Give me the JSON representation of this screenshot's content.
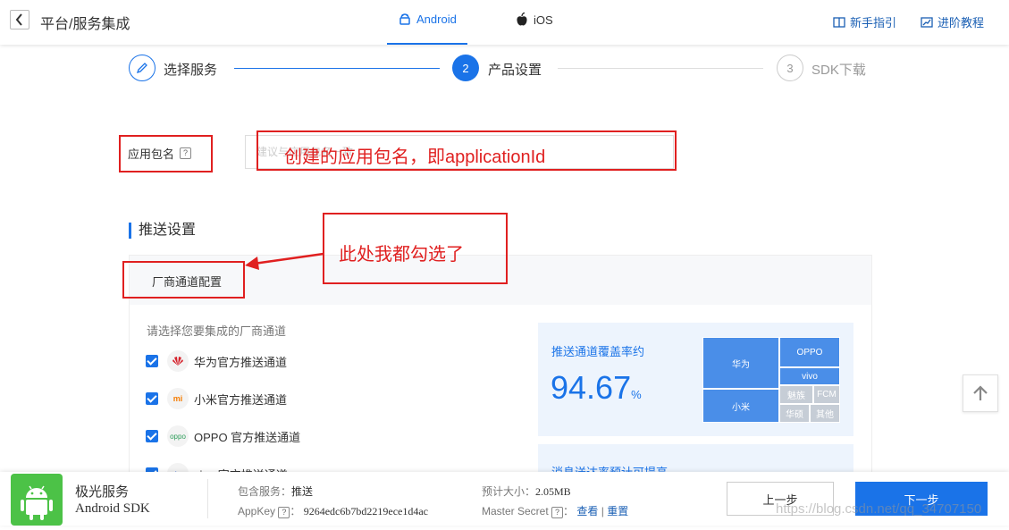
{
  "header": {
    "title": "平台/服务集成",
    "tabs": [
      {
        "label": "Android",
        "icon": "android-icon",
        "active": true
      },
      {
        "label": "iOS",
        "icon": "apple-icon",
        "active": false
      }
    ],
    "links": [
      {
        "label": "新手指引",
        "icon": "book-icon"
      },
      {
        "label": "进阶教程",
        "icon": "chart-icon"
      }
    ]
  },
  "steps": [
    {
      "label": "选择服务",
      "state": "done"
    },
    {
      "num": "2",
      "label": "产品设置",
      "state": "active"
    },
    {
      "num": "3",
      "label": "SDK下载",
      "state": "pending"
    }
  ],
  "form": {
    "package_label": "应用包名",
    "package_placeholder": "建议与应用包名一致"
  },
  "annotations": {
    "package_note": "创建的应用包名，即applicationId",
    "vendor_note": "此处我都勾选了"
  },
  "push": {
    "section_title": "推送设置",
    "vendor_header": "厂商通道配置",
    "prompt": "请选择您要集成的厂商通道",
    "vendors": [
      {
        "label": "华为官方推送通道",
        "logo": "huawei-icon",
        "checked": true
      },
      {
        "label": "小米官方推送通道",
        "logo": "xiaomi-icon",
        "checked": true
      },
      {
        "label": "OPPO 官方推送通道",
        "logo": "oppo-icon",
        "checked": true
      },
      {
        "label": "vivo 官方推送通道",
        "logo": "vivo-icon",
        "checked": true
      }
    ],
    "coverage_title": "推送通道覆盖率约",
    "coverage_value": "94.67",
    "coverage_unit": "%",
    "treemap": [
      "华为",
      "OPPO",
      "vivo",
      "小米",
      "魅族",
      "FCM",
      "华硕",
      "其他"
    ],
    "promo_text": "消息送达率预计可提高"
  },
  "footer": {
    "service_name": "极光服务",
    "sdk_name": "Android SDK",
    "includes_label": "包含服务：",
    "includes_value": "推送",
    "appkey_label": "AppKey",
    "appkey_value": "9264edc6b7bd2219ece1d4ac",
    "size_label": "预计大小：",
    "size_value": "2.05MB",
    "secret_label": "Master Secret",
    "secret_view": "查看",
    "secret_sep": "|",
    "secret_reset": "重置",
    "prev_label": "上一步",
    "next_label": "下一步"
  },
  "watermark": "https://blog.csdn.net/qq_34707150",
  "colors": {
    "accent": "#1a73e8",
    "annotation": "#e02020",
    "android_green": "#4cc247"
  }
}
